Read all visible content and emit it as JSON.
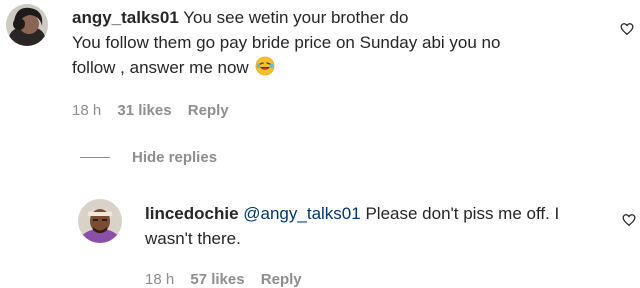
{
  "comments": [
    {
      "username": "angy_talks01",
      "text_line1": "You see wetin your brother do",
      "text_line2": "You follow them go pay bride price on Sunday abi you no",
      "text_line3": "follow , answer me now",
      "emoji": "laughing-face-emoji",
      "time": "18 h",
      "likes": "31 likes",
      "reply_label": "Reply"
    }
  ],
  "hide_replies_label": "Hide replies",
  "replies": [
    {
      "username": "lincedochie",
      "mention": "@angy_talks01",
      "text_line1": "Please don't piss me off. I",
      "text_line2": "wasn't there.",
      "time": "18 h",
      "likes": "57 likes",
      "reply_label": "Reply"
    }
  ],
  "icons": {
    "like": "heart-icon"
  },
  "colors": {
    "text": "#262626",
    "meta": "#8e8e8e",
    "mention": "#00376b"
  }
}
